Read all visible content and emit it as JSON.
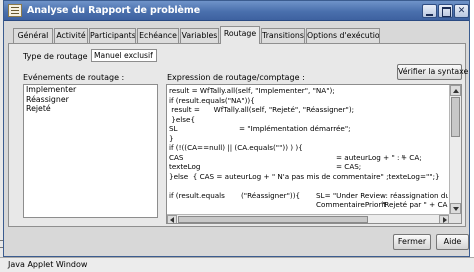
{
  "window": {
    "title": "Analyse du Rapport de problème",
    "minimize_glyph": "",
    "maximize_glyph": "",
    "close_glyph": "✕"
  },
  "tabs": [
    {
      "label": "Général",
      "active": false
    },
    {
      "label": "Activité",
      "active": false
    },
    {
      "label": "Participants",
      "active": false
    },
    {
      "label": "Echéance",
      "active": false
    },
    {
      "label": "Variables",
      "active": false
    },
    {
      "label": "Routage",
      "active": true
    },
    {
      "label": "Transitions",
      "active": false
    },
    {
      "label": "Options d'exécution",
      "active": false
    }
  ],
  "routing": {
    "type_label": "Type de routage :",
    "type_value": "Manuel exclusif",
    "events_label": "Evénements de routage :",
    "events": [
      "Implementer",
      "Réassigner",
      "Rejeté"
    ],
    "expression_label": "Expression de routage/comptage :",
    "verify_button": "Vérifier la syntaxe",
    "code_lines": [
      [
        "result = WfTally.all(self, \"Implementer\", \"NA\");"
      ],
      [
        "if (result.equals(\"NA\")){"
      ],
      [
        " result =      WfTally.all(self, \"Rejeté\", \"Réassigner\");"
      ],
      [
        " }else{"
      ],
      [
        "SL",
        "= \"Implémentation démarrée\";"
      ],
      [
        "}"
      ],
      [
        "if (!((CA==null) || (CA.equals(\"\")) ) ){"
      ],
      [
        "CAS",
        "= auteurLog + \" : \"",
        "+ CA;"
      ],
      [
        "texteLog",
        "= CAS;"
      ],
      [
        "}else  { CAS = auteurLog + \" N'a pas mis de commentaire\" ;texteLog=\"\";}"
      ],
      [
        ""
      ],
      [
        "if (result.equals",
        "(\"Réassigner\")){",
        "SL= \"Under Review: réassignation du RP demar"
      ],
      [
        "",
        "CommentairePriorit",
        "\"Rejeté par \" + CA"
      ]
    ]
  },
  "buttons": {
    "close": "Fermer",
    "help": "Aide"
  },
  "status_bar": "Java Applet Window",
  "colors": {
    "titlebar": "#4a70ad",
    "window_bg": "#e8e8e8"
  }
}
